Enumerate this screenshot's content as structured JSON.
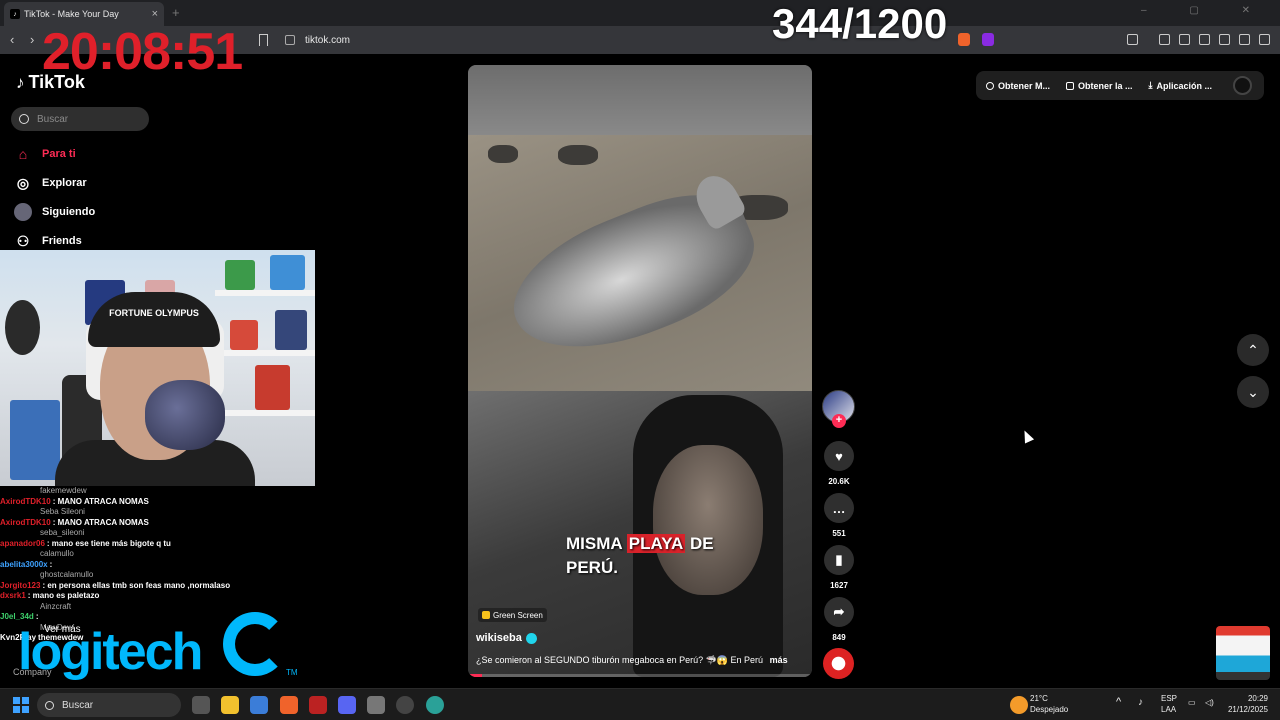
{
  "browser": {
    "tab_title": "TikTok - Make Your Day",
    "tab_close": "×",
    "new_tab": "+",
    "url": "tiktok.com"
  },
  "overlay": {
    "clock": "20:08:51",
    "counter": "344/1200"
  },
  "sidebar": {
    "logo": "TikTok",
    "search_placeholder": "Buscar",
    "items": [
      {
        "label": "Para ti",
        "icon": "home-icon",
        "active": true
      },
      {
        "label": "Explorar",
        "icon": "compass-icon",
        "active": false
      },
      {
        "label": "Siguiendo",
        "icon": "following-avatar-icon",
        "active": false
      },
      {
        "label": "Friends",
        "icon": "friends-icon",
        "active": false
      }
    ]
  },
  "webcam": {
    "cap_text": "FORTUNE OLYMPUS"
  },
  "chat": [
    {
      "name": "",
      "text": "fakemewdew",
      "color": "#aaaaaa",
      "faint": true
    },
    {
      "name": "AxirodTDK10",
      "text": ": MANO ATRACA NOMAS",
      "color": "#e0202a",
      "faint": false
    },
    {
      "name": "",
      "text": "Seba Sileoni",
      "color": "#aaaaaa",
      "faint": true
    },
    {
      "name": "AxirodTDK10",
      "text": ": MANO ATRACA NOMAS",
      "color": "#e0202a",
      "faint": false
    },
    {
      "name": "",
      "text": "seba_sileoni",
      "color": "#aaaaaa",
      "faint": true
    },
    {
      "name": "apanador06",
      "text": ": mano ese tiene más bigote q tu",
      "color": "#e0202a",
      "faint": false
    },
    {
      "name": "",
      "text": "calamullo",
      "color": "#aaaaaa",
      "faint": true
    },
    {
      "name": "abelita3000x",
      "text": ":",
      "color": "#3ea2ff",
      "faint": false
    },
    {
      "name": "",
      "text": "ghostcalamullo",
      "color": "#aaaaaa",
      "faint": true
    },
    {
      "name": "Jorgito123",
      "text": ": en persona ellas tmb son feas mano ,normalaso",
      "color": "#e0202a",
      "faint": false
    },
    {
      "name": "dxsrk1",
      "text": ": mano es paletazo",
      "color": "#e0202a",
      "faint": false
    },
    {
      "name": "",
      "text": "Ainzcraft",
      "color": "#aaaaaa",
      "faint": true
    },
    {
      "name": "J0el_34d",
      "text": ":",
      "color": "#3ecf6b",
      "faint": false
    },
    {
      "name": "",
      "text": "MewDew",
      "color": "#aaaaaa",
      "faint": true
    },
    {
      "name": "Kvn2Play",
      "text": "themewdew",
      "color": "#ffffff",
      "faint": false
    }
  ],
  "sponsor": {
    "ver_mas": "Ver más",
    "brand": "logitech",
    "tm": "TM",
    "company": "Company"
  },
  "video": {
    "caption_line1_a": "MISMA",
    "caption_line1_hl": "PLAYA",
    "caption_line1_b": "DE",
    "caption_line2": "PERÚ.",
    "effect": "Green Screen",
    "author": "wikiseba",
    "description": "¿Se comieron al SEGUNDO tiburón megaboca en Perú? 🦈😱 En Perú",
    "more": "más",
    "progress": 0.04
  },
  "actions": {
    "follow": "+",
    "likes": "20.6K",
    "comments": "551",
    "saves": "1627",
    "shares": "849"
  },
  "topbar": {
    "items": [
      "Obtener M...",
      "Obtener la ...",
      "Aplicación ..."
    ]
  },
  "nav_arrows": {
    "up": "⌃",
    "down": "⌄"
  },
  "taskbar": {
    "search": "Buscar",
    "weather_temp": "21°C",
    "weather_desc": "Despejado",
    "lang": "ESP",
    "lang_sub": "LAA",
    "time": "20:29",
    "date": "21/12/2025"
  },
  "colors": {
    "tiktok_red": "#fe2c55",
    "logitech_blue": "#00b8fc",
    "clock_red": "#e0202a"
  }
}
